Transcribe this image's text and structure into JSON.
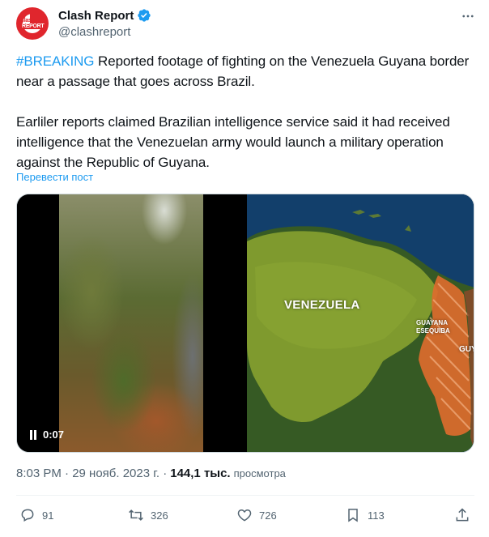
{
  "author": {
    "display_name": "Clash Report",
    "handle": "@clashreport",
    "avatar_text_top": "Clash",
    "avatar_text_bottom": "REPORT",
    "verified_color": "#1d9bf0"
  },
  "post": {
    "hashtag": "#BREAKING",
    "line1_rest": " Reported footage of fighting on the Venezuela Guyana border near a passage that goes across Brazil.",
    "paragraph2": "Earliler reports claimed Brazilian intelligence service said it had received intelligence that the Venezuelan army would launch a military operation against the Republic of Guyana.",
    "translate_link": "Перевести пост"
  },
  "media": {
    "video_time": "0:07",
    "map_labels": {
      "venezuela": "VENEZUELA",
      "guayana_line1": "GUAYANA",
      "guayana_line2": "ESEQUIBA",
      "guyana_partial": "GUY"
    }
  },
  "meta": {
    "timestamp": "8:03 PM · 29 нояб. 2023 г. ·",
    "views_count": "144,1 тыс.",
    "views_label": "просмотра"
  },
  "actions": {
    "replies": "91",
    "reposts": "326",
    "likes": "726",
    "bookmarks": "113"
  },
  "colors": {
    "accent": "#1d9bf0",
    "secondary_text": "#536471",
    "brand_red": "#e0262d"
  }
}
